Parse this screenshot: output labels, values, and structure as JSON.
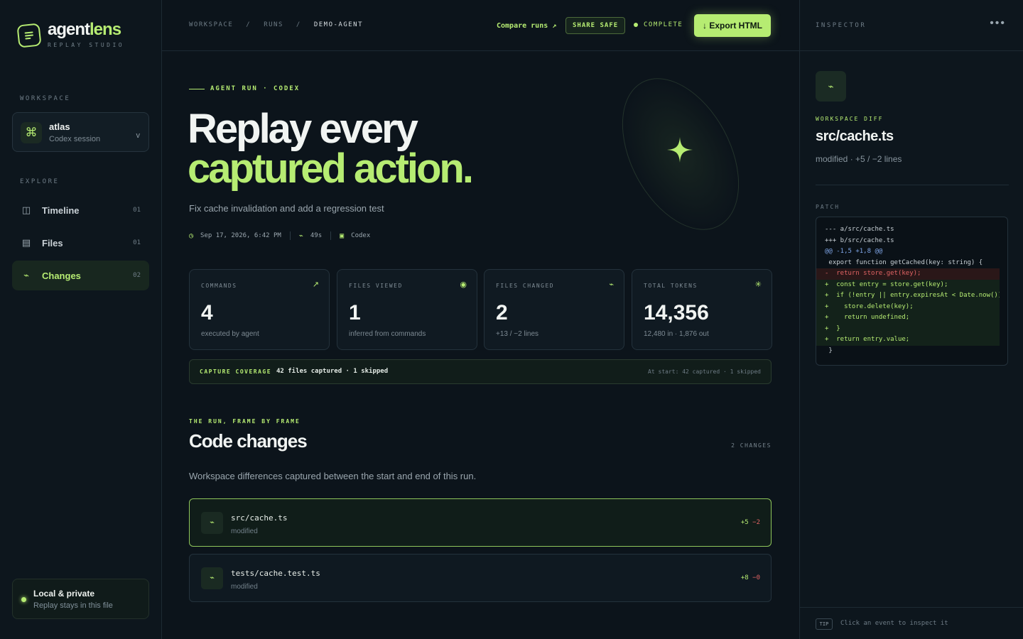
{
  "brand": {
    "name_a": "agent",
    "name_b": "lens",
    "subtitle": "REPLAY STUDIO"
  },
  "sidebar": {
    "workspace_label": "WORKSPACE",
    "workspace": {
      "name": "atlas",
      "subtitle": "Codex session",
      "chevron": "v",
      "icon": "command-icon"
    },
    "explore_label": "EXPLORE",
    "items": [
      {
        "label": "Timeline",
        "count": "01",
        "icon": "columns-icon",
        "active": false
      },
      {
        "label": "Files",
        "count": "01",
        "icon": "file-list-icon",
        "active": false
      },
      {
        "label": "Changes",
        "count": "02",
        "icon": "diff-icon",
        "active": true
      }
    ],
    "local": {
      "title": "Local & private",
      "subtitle": "Replay stays in this file"
    }
  },
  "topbar": {
    "breadcrumb": [
      "WORKSPACE",
      "/",
      "RUNS",
      "/",
      "DEMO-AGENT"
    ],
    "compare_label": "Compare runs ↗",
    "share_label": "SHARE SAFE",
    "status_label": "COMPLETE",
    "export_label": "↓ Export HTML"
  },
  "hero": {
    "eyebrow": "AGENT RUN · CODEX",
    "title_line1": "Replay every",
    "title_line2": "captured action.",
    "subtitle": "Fix cache invalidation and add a regression test",
    "meta": {
      "date": "Sep 17, 2026, 6:42 PM",
      "duration": "49s",
      "agent": "Codex"
    }
  },
  "stats": [
    {
      "label": "COMMANDS",
      "value": "4",
      "sub": "executed by agent",
      "icon": "arrow-up-right-icon"
    },
    {
      "label": "FILES VIEWED",
      "value": "1",
      "sub": "inferred from commands",
      "icon": "eye-icon"
    },
    {
      "label": "FILES CHANGED",
      "value": "2",
      "sub": "+13 / −2 lines",
      "icon": "diff-icon"
    },
    {
      "label": "TOTAL TOKENS",
      "value": "14,356",
      "sub": "12,480 in · 1,876 out",
      "icon": "sparkle-icon"
    }
  ],
  "coverage": {
    "label": "CAPTURE COVERAGE",
    "value": "42 files captured · 1 skipped",
    "right": "At start: 42 captured · 1 skipped"
  },
  "changes_section": {
    "eyebrow": "THE RUN, FRAME BY FRAME",
    "title": "Code changes",
    "count": "2 CHANGES",
    "description": "Workspace differences captured between the start and end of this run.",
    "items": [
      {
        "path": "src/cache.ts",
        "status": "modified",
        "added": "+5",
        "removed": "−2",
        "active": true
      },
      {
        "path": "tests/cache.test.ts",
        "status": "modified",
        "added": "+8",
        "removed": "−0",
        "active": false
      }
    ]
  },
  "inspector": {
    "title": "INSPECTOR",
    "more": "•••",
    "eyebrow": "WORKSPACE DIFF",
    "file": "src/cache.ts",
    "meta": "modified · +5 / −2 lines",
    "patch_label": "PATCH",
    "patch": [
      {
        "kind": "ctx",
        "text": "--- a/src/cache.ts"
      },
      {
        "kind": "ctx",
        "text": "+++ b/src/cache.ts"
      },
      {
        "kind": "hunk",
        "text": "@@ -1,5 +1,8 @@"
      },
      {
        "kind": "ctx",
        "text": " export function getCached(key: string) {"
      },
      {
        "kind": "minus",
        "text": "-  return store.get(key);"
      },
      {
        "kind": "plus",
        "text": "+  const entry = store.get(key);"
      },
      {
        "kind": "plus",
        "text": "+  if (!entry || entry.expiresAt < Date.now())"
      },
      {
        "kind": "plus",
        "text": "+    store.delete(key);"
      },
      {
        "kind": "plus",
        "text": "+    return undefined;"
      },
      {
        "kind": "plus",
        "text": "+  }"
      },
      {
        "kind": "plus",
        "text": "+  return entry.value;"
      },
      {
        "kind": "ctx",
        "text": " }"
      }
    ],
    "tip_badge": "TIP",
    "tip_text": "Click an event to inspect it"
  },
  "colors": {
    "accent": "#b6ec72",
    "background": "#0c141b",
    "removed": "#e06363"
  }
}
